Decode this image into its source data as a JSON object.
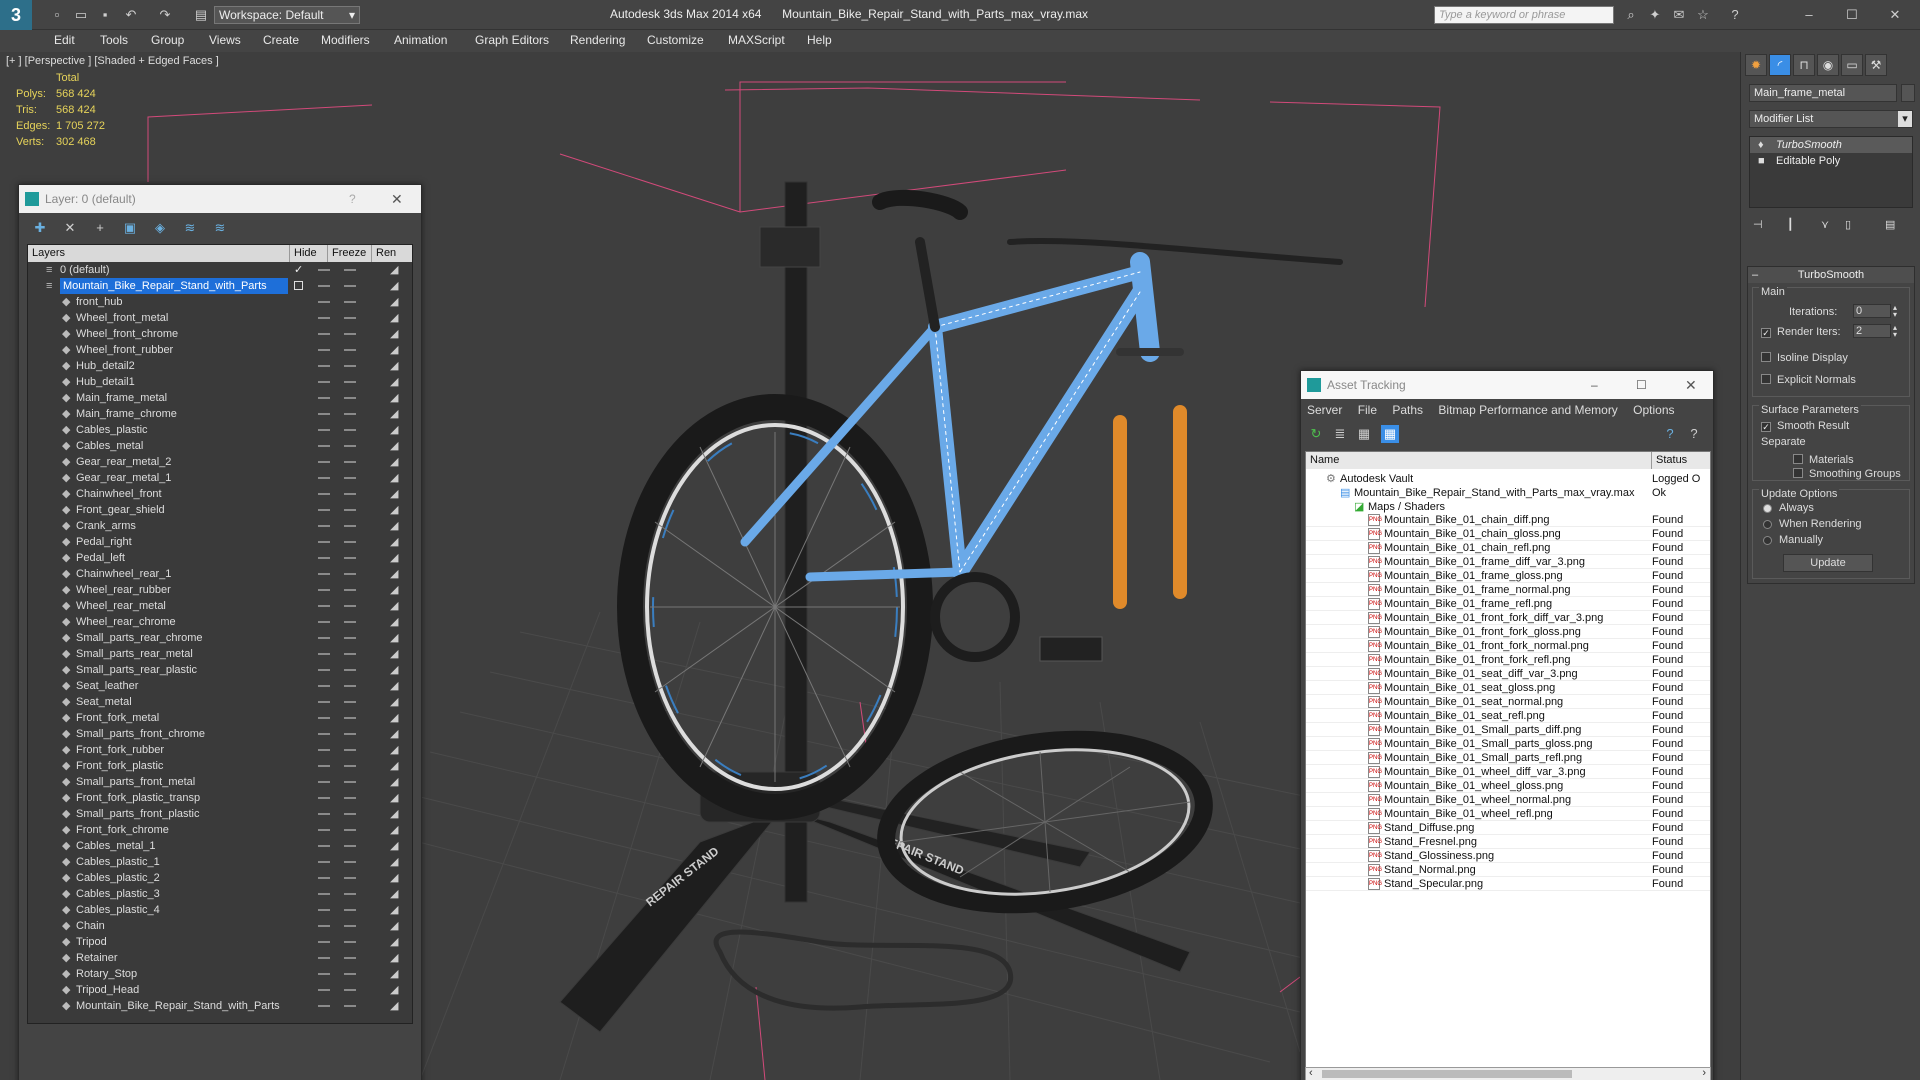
{
  "window": {
    "app_title": "Autodesk 3ds Max  2014 x64",
    "file_title": "Mountain_Bike_Repair_Stand_with_Parts_max_vray.max",
    "workspace": "Workspace: Default",
    "search_placeholder": "Type a keyword or phrase"
  },
  "menu": [
    "Edit",
    "Tools",
    "Group",
    "Views",
    "Create",
    "Modifiers",
    "Animation",
    "Graph Editors",
    "Rendering",
    "Customize",
    "MAXScript",
    "Help"
  ],
  "viewport": {
    "label": "[+ ] [Perspective ] [Shaded + Edged Faces ]",
    "stats": {
      "header": "Total",
      "rows": [
        {
          "label": "Polys:",
          "value": "568 424"
        },
        {
          "label": "Tris:",
          "value": "568 424"
        },
        {
          "label": "Edges:",
          "value": "1 705 272"
        },
        {
          "label": "Verts:",
          "value": "302 468"
        }
      ]
    },
    "stand_text_1": "REPAIR STAND",
    "stand_text_2": "REPAIR STAND"
  },
  "layer_dialog": {
    "title": "Layer: 0 (default)",
    "help": "?",
    "columns": {
      "layers": "Layers",
      "hide": "Hide",
      "freeze": "Freeze",
      "render": "Ren"
    },
    "items": [
      {
        "name": "0 (default)",
        "level": 0
      },
      {
        "name": "Mountain_Bike_Repair_Stand_with_Parts",
        "level": 0
      },
      {
        "name": "front_hub",
        "level": 1
      },
      {
        "name": "Wheel_front_metal",
        "level": 1
      },
      {
        "name": "Wheel_front_chrome",
        "level": 1
      },
      {
        "name": "Wheel_front_rubber",
        "level": 1
      },
      {
        "name": "Hub_detail2",
        "level": 1
      },
      {
        "name": "Hub_detail1",
        "level": 1
      },
      {
        "name": "Main_frame_metal",
        "level": 1
      },
      {
        "name": "Main_frame_chrome",
        "level": 1
      },
      {
        "name": "Cables_plastic",
        "level": 1
      },
      {
        "name": "Cables_metal",
        "level": 1
      },
      {
        "name": "Gear_rear_metal_2",
        "level": 1
      },
      {
        "name": "Gear_rear_metal_1",
        "level": 1
      },
      {
        "name": "Chainwheel_front",
        "level": 1
      },
      {
        "name": "Front_gear_shield",
        "level": 1
      },
      {
        "name": "Crank_arms",
        "level": 1
      },
      {
        "name": "Pedal_right",
        "level": 1
      },
      {
        "name": "Pedal_left",
        "level": 1
      },
      {
        "name": "Chainwheel_rear_1",
        "level": 1
      },
      {
        "name": "Wheel_rear_rubber",
        "level": 1
      },
      {
        "name": "Wheel_rear_metal",
        "level": 1
      },
      {
        "name": "Wheel_rear_chrome",
        "level": 1
      },
      {
        "name": "Small_parts_rear_chrome",
        "level": 1
      },
      {
        "name": "Small_parts_rear_metal",
        "level": 1
      },
      {
        "name": "Small_parts_rear_plastic",
        "level": 1
      },
      {
        "name": "Seat_leather",
        "level": 1
      },
      {
        "name": "Seat_metal",
        "level": 1
      },
      {
        "name": "Front_fork_metal",
        "level": 1
      },
      {
        "name": "Small_parts_front_chrome",
        "level": 1
      },
      {
        "name": "Front_fork_rubber",
        "level": 1
      },
      {
        "name": "Front_fork_plastic",
        "level": 1
      },
      {
        "name": "Small_parts_front_metal",
        "level": 1
      },
      {
        "name": "Front_fork_plastic_transp",
        "level": 1
      },
      {
        "name": "Small_parts_front_plastic",
        "level": 1
      },
      {
        "name": "Front_fork_chrome",
        "level": 1
      },
      {
        "name": "Cables_metal_1",
        "level": 1
      },
      {
        "name": "Cables_plastic_1",
        "level": 1
      },
      {
        "name": "Cables_plastic_2",
        "level": 1
      },
      {
        "name": "Cables_plastic_3",
        "level": 1
      },
      {
        "name": "Cables_plastic_4",
        "level": 1
      },
      {
        "name": "Chain",
        "level": 1
      },
      {
        "name": "Tripod",
        "level": 1
      },
      {
        "name": "Retainer",
        "level": 1
      },
      {
        "name": "Rotary_Stop",
        "level": 1
      },
      {
        "name": "Tripod_Head",
        "level": 1
      },
      {
        "name": "Mountain_Bike_Repair_Stand_with_Parts",
        "level": 1
      }
    ]
  },
  "asset_dialog": {
    "title": "Asset Tracking",
    "menu": [
      "Server",
      "File",
      "Paths",
      "Bitmap Performance and Memory",
      "Options"
    ],
    "columns": {
      "name": "Name",
      "status": "Status"
    },
    "vault": {
      "name": "Autodesk Vault",
      "status": "Logged O"
    },
    "file": {
      "name": "Mountain_Bike_Repair_Stand_with_Parts_max_vray.max",
      "status": "Ok"
    },
    "group": "Maps / Shaders",
    "assets": [
      {
        "name": "Mountain_Bike_01_chain_diff.png",
        "status": "Found"
      },
      {
        "name": "Mountain_Bike_01_chain_gloss.png",
        "status": "Found"
      },
      {
        "name": "Mountain_Bike_01_chain_refl.png",
        "status": "Found"
      },
      {
        "name": "Mountain_Bike_01_frame_diff_var_3.png",
        "status": "Found"
      },
      {
        "name": "Mountain_Bike_01_frame_gloss.png",
        "status": "Found"
      },
      {
        "name": "Mountain_Bike_01_frame_normal.png",
        "status": "Found"
      },
      {
        "name": "Mountain_Bike_01_frame_refl.png",
        "status": "Found"
      },
      {
        "name": "Mountain_Bike_01_front_fork_diff_var_3.png",
        "status": "Found"
      },
      {
        "name": "Mountain_Bike_01_front_fork_gloss.png",
        "status": "Found"
      },
      {
        "name": "Mountain_Bike_01_front_fork_normal.png",
        "status": "Found"
      },
      {
        "name": "Mountain_Bike_01_front_fork_refl.png",
        "status": "Found"
      },
      {
        "name": "Mountain_Bike_01_seat_diff_var_3.png",
        "status": "Found"
      },
      {
        "name": "Mountain_Bike_01_seat_gloss.png",
        "status": "Found"
      },
      {
        "name": "Mountain_Bike_01_seat_normal.png",
        "status": "Found"
      },
      {
        "name": "Mountain_Bike_01_seat_refl.png",
        "status": "Found"
      },
      {
        "name": "Mountain_Bike_01_Small_parts_diff.png",
        "status": "Found"
      },
      {
        "name": "Mountain_Bike_01_Small_parts_gloss.png",
        "status": "Found"
      },
      {
        "name": "Mountain_Bike_01_Small_parts_refl.png",
        "status": "Found"
      },
      {
        "name": "Mountain_Bike_01_wheel_diff_var_3.png",
        "status": "Found"
      },
      {
        "name": "Mountain_Bike_01_wheel_gloss.png",
        "status": "Found"
      },
      {
        "name": "Mountain_Bike_01_wheel_normal.png",
        "status": "Found"
      },
      {
        "name": "Mountain_Bike_01_wheel_refl.png",
        "status": "Found"
      },
      {
        "name": "Stand_Diffuse.png",
        "status": "Found"
      },
      {
        "name": "Stand_Fresnel.png",
        "status": "Found"
      },
      {
        "name": "Stand_Glossiness.png",
        "status": "Found"
      },
      {
        "name": "Stand_Normal.png",
        "status": "Found"
      },
      {
        "name": "Stand_Specular.png",
        "status": "Found"
      }
    ]
  },
  "command_panel": {
    "object_name": "Main_frame_metal",
    "modifier_list": "Modifier List",
    "stack": [
      "TurboSmooth",
      "Editable Poly"
    ],
    "rollout_title": "TurboSmooth",
    "main_group": "Main",
    "iterations_label": "Iterations:",
    "iterations_value": "0",
    "render_iters_label": "Render Iters:",
    "render_iters_value": "2",
    "isoline_display": "Isoline Display",
    "explicit_normals": "Explicit Normals",
    "surface_group": "Surface Parameters",
    "smooth_result": "Smooth Result",
    "separate_label": "Separate",
    "materials": "Materials",
    "smoothing_groups": "Smoothing Groups",
    "update_group": "Update Options",
    "always": "Always",
    "when_rendering": "When Rendering",
    "manually": "Manually",
    "update_button": "Update"
  },
  "colors": {
    "accent": "#3a8ee6",
    "selection": "#1e6fd9",
    "stats": "#e6d35a",
    "bbox": "#d24a7a",
    "found": "#111111"
  }
}
